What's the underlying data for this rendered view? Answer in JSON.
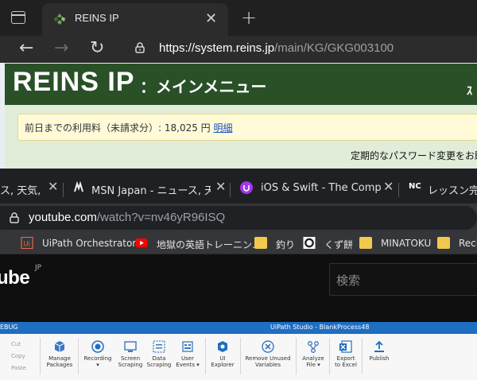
{
  "win1": {
    "tab_title": "REINS IP",
    "url_host": "https://system.reins.jp",
    "url_path": "/main/KG/GKG003100",
    "logo": "REINS IP",
    "menu_title": "：メインメニュー",
    "banner_right": "ｽ",
    "notice_text": "前日までの利用料（未請求分）: 18,025 円 ",
    "notice_link": "明細",
    "password_notice": "定期的なパスワード変更をお願",
    "icons": {
      "tab_actions": "tab-actions-icon",
      "favicon": "reins-favicon-icon",
      "close": "close-icon",
      "new_tab": "plus-icon",
      "back": "back-arrow-icon",
      "forward": "forward-arrow-icon",
      "reload": "reload-icon",
      "lock": "lock-icon"
    },
    "tab_close_glyph": "✕",
    "new_tab_glyph": "+",
    "back_glyph": "←",
    "forward_glyph": "→",
    "reload_glyph": "↻"
  },
  "win2": {
    "tabs": [
      {
        "title": "ス, 天気, ",
        "favicon": "none"
      },
      {
        "title": "MSN Japan - ニュース, 天気, ",
        "favicon": "msn-icon"
      },
      {
        "title": "iOS & Swift - The Complete",
        "favicon": "udemy-icon"
      },
      {
        "title": "レッスン完了",
        "favicon": "nc-icon"
      }
    ],
    "tab_close_glyph": "✕",
    "url_host": "youtube.com",
    "url_path": "/watch?v=nv46yR96ISQ",
    "bookmarks": [
      {
        "label": "UiPath Orchestrator",
        "icon": "uipath-icon"
      },
      {
        "label": "地獄の英語トレーニン...",
        "icon": "youtube-icon"
      },
      {
        "label": "釣り",
        "icon": "folder-icon"
      },
      {
        "label": "くず餅",
        "icon": "circle-logo-icon"
      },
      {
        "label": "MINATOKU",
        "icon": "folder-icon"
      },
      {
        "label": "Recla",
        "icon": "folder-icon"
      }
    ],
    "yt_logo": "ube",
    "yt_region": "JP",
    "search_placeholder": "検索",
    "nc_label": "NC"
  },
  "win3": {
    "debug_label": "EBUG",
    "title": "UiPath Studio - BlankProcess48",
    "clipboard": [
      "Cut",
      "Copy",
      "Paste"
    ],
    "buttons": [
      {
        "label": "Manage\nPackages",
        "icon": "packages-icon"
      },
      {
        "label": "Recording\n▾",
        "icon": "record-icon"
      },
      {
        "label": "Screen\nScraping",
        "icon": "screen-scraping-icon"
      },
      {
        "label": "Data\nScraping",
        "icon": "data-scraping-icon"
      },
      {
        "label": "User\nEvents ▾",
        "icon": "user-events-icon"
      },
      {
        "label": "UI\nExplorer",
        "icon": "ui-explorer-icon"
      },
      {
        "label": "Remove Unused\nVariables",
        "icon": "remove-unused-icon"
      },
      {
        "label": "Analyze\nFile ▾",
        "icon": "analyze-file-icon"
      },
      {
        "label": "Export\nto Excel",
        "icon": "excel-icon"
      },
      {
        "label": "Publish",
        "icon": "publish-icon"
      }
    ]
  },
  "colors": {
    "reins_green": "#2a5027",
    "notice_bg": "#fffbd8",
    "link": "#1a4fc4",
    "uipath_blue": "#1e6ec2",
    "youtube_red": "#ff0000"
  }
}
